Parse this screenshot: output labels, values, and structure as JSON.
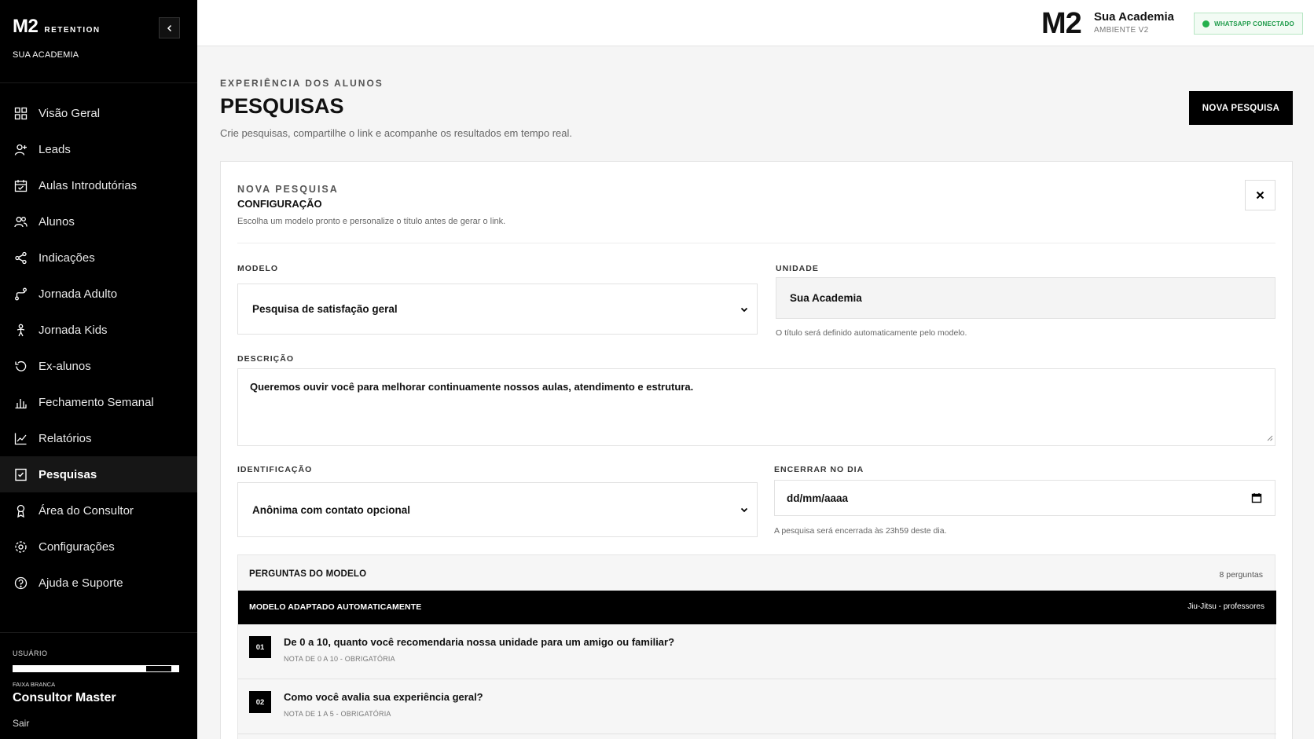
{
  "brand": {
    "logo": "M2",
    "logo_sub": "RETENTION",
    "academy": "SUA ACADEMIA"
  },
  "nav": [
    {
      "label": "Visão Geral",
      "icon": "grid-icon"
    },
    {
      "label": "Leads",
      "icon": "user-plus-icon"
    },
    {
      "label": "Aulas Introdutórias",
      "icon": "calendar-icon"
    },
    {
      "label": "Alunos",
      "icon": "users-icon"
    },
    {
      "label": "Indicações",
      "icon": "share-icon"
    },
    {
      "label": "Jornada Adulto",
      "icon": "route-icon"
    },
    {
      "label": "Jornada Kids",
      "icon": "child-icon"
    },
    {
      "label": "Ex-alunos",
      "icon": "history-icon"
    },
    {
      "label": "Fechamento Semanal",
      "icon": "bar-chart-icon"
    },
    {
      "label": "Relatórios",
      "icon": "line-chart-icon"
    },
    {
      "label": "Pesquisas",
      "icon": "checklist-icon",
      "active": true
    },
    {
      "label": "Área do Consultor",
      "icon": "award-icon"
    },
    {
      "label": "Configurações",
      "icon": "gear-icon"
    },
    {
      "label": "Ajuda e Suporte",
      "icon": "help-icon"
    }
  ],
  "user": {
    "label": "USUÁRIO",
    "belt": "FAIXA BRANCA",
    "name": "Consultor Master",
    "logout": "Sair"
  },
  "topbar": {
    "logo": "M2",
    "academy": "Sua Academia",
    "env": "AMBIENTE V2",
    "whatsapp": "WHATSAPP CONECTADO",
    "whatsapp_color": "#25b04d"
  },
  "header": {
    "eyebrow": "EXPERIÊNCIA DOS ALUNOS",
    "title": "PESQUISAS",
    "subtitle": "Crie pesquisas, compartilhe o link e acompanhe os resultados em tempo real.",
    "new_button": "NOVA PESQUISA"
  },
  "form": {
    "eyebrow": "NOVA PESQUISA",
    "title": "CONFIGURAÇÃO",
    "subtitle": "Escolha um modelo pronto e personalize o título antes de gerar o link.",
    "model_label": "MODELO",
    "model_value": "Pesquisa de satisfação geral",
    "unit_label": "UNIDADE",
    "unit_value": "Sua Academia",
    "unit_hint": "O título será definido automaticamente pelo modelo.",
    "description_label": "DESCRIÇÃO",
    "description_value": "Queremos ouvir você para melhorar continuamente nossos aulas, atendimento e estrutura.",
    "identification_label": "IDENTIFICAÇÃO",
    "identification_value": "Anônima com contato opcional",
    "end_label": "ENCERRAR NO DIA",
    "end_placeholder": "dd/mm/aaaa",
    "end_hint": "A pesquisa será encerrada às 23h59 deste dia."
  },
  "questions": {
    "title": "PERGUNTAS DO MODELO",
    "count": "8 perguntas",
    "band_left": "MODELO ADAPTADO AUTOMATICAMENTE",
    "band_right": "Jiu-Jitsu - professores",
    "items": [
      {
        "num": "01",
        "text": "De 0 a 10, quanto você recomendaria nossa unidade para um amigo ou familiar?",
        "meta": "NOTA DE 0 A 10 - OBRIGATÓRIA"
      },
      {
        "num": "02",
        "text": "Como você avalia sua experiência geral?",
        "meta": "NOTA DE 1 A 5 - OBRIGATÓRIA"
      }
    ]
  }
}
